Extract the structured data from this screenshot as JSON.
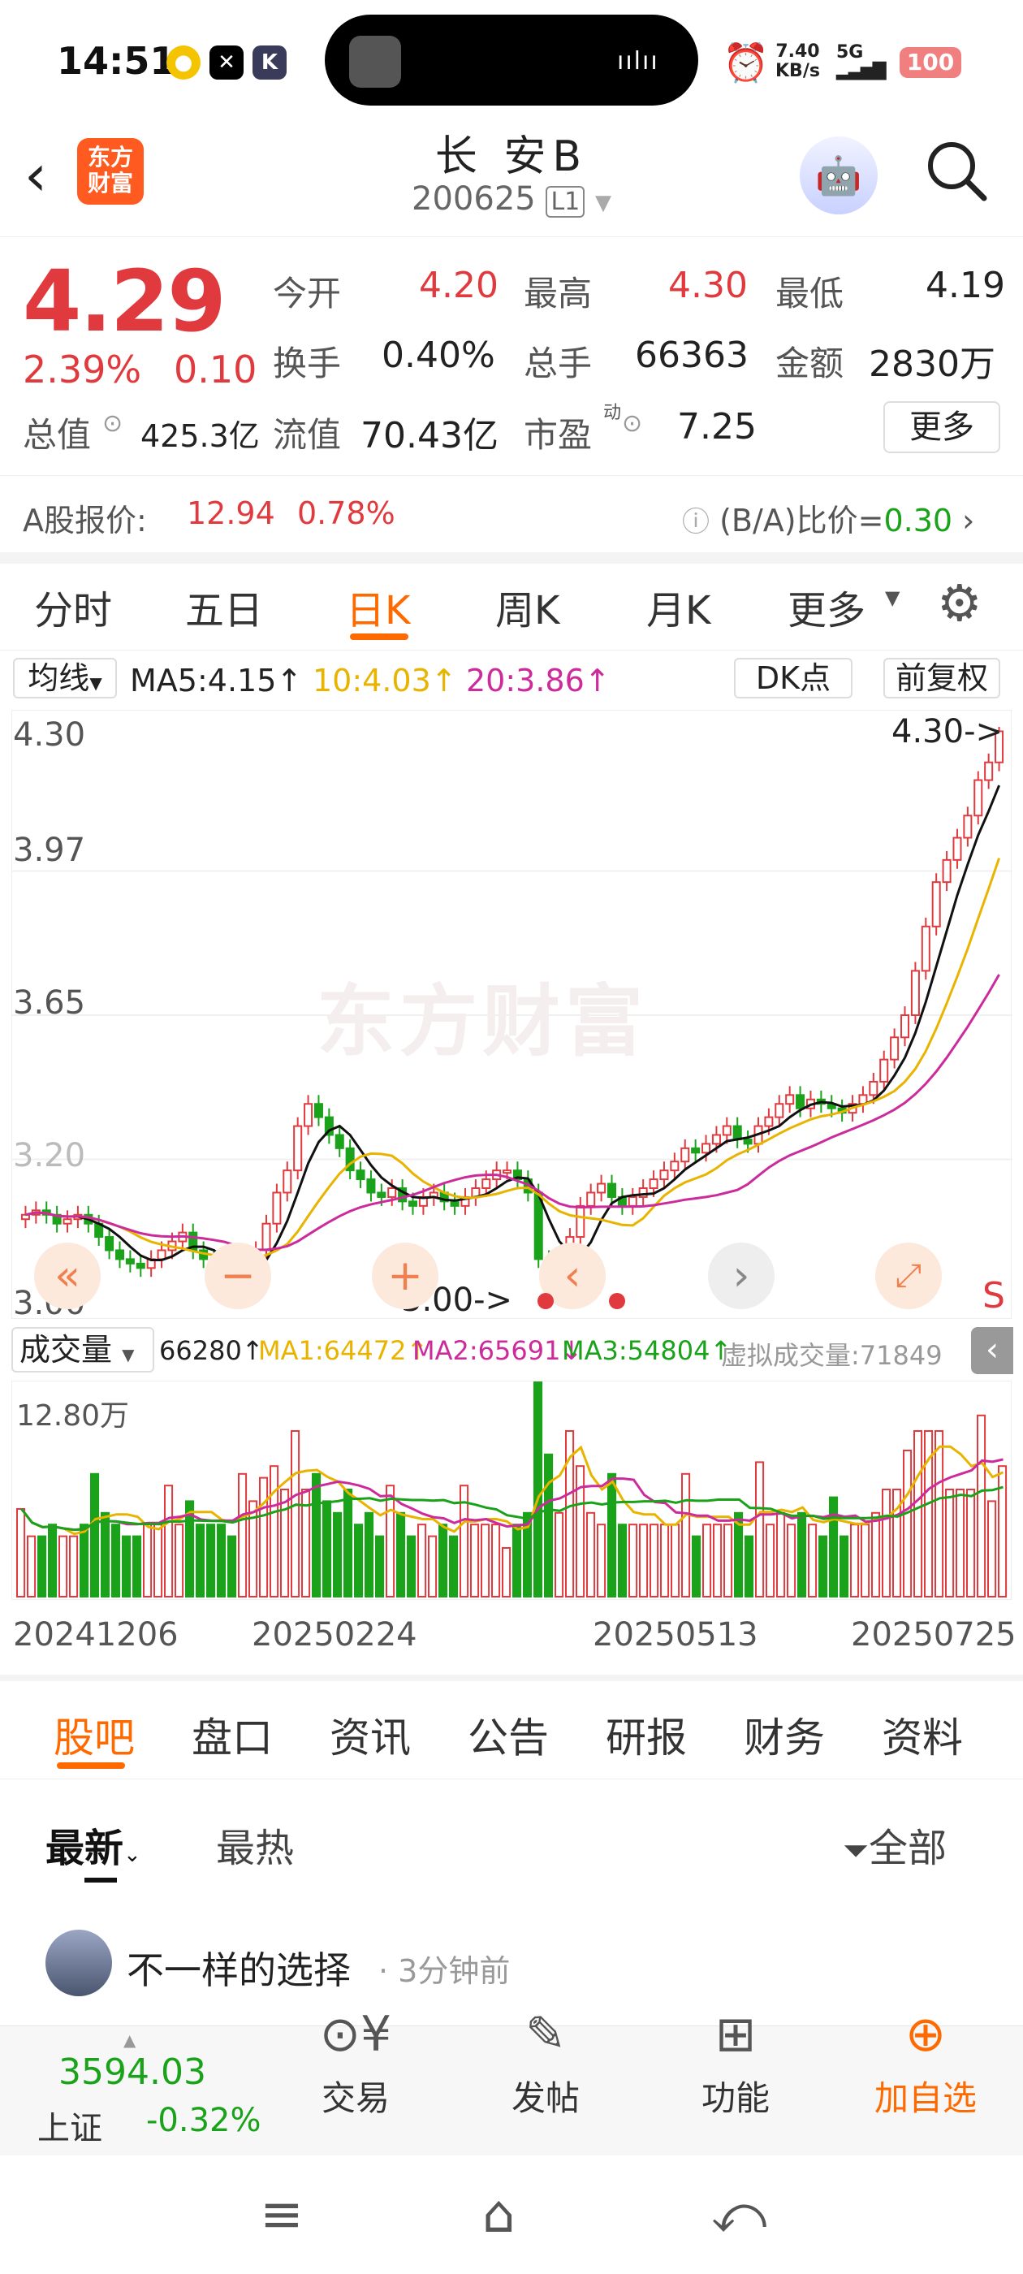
{
  "status": {
    "time": "14:51",
    "net": "7.40",
    "net_unit": "KB/s",
    "signal": "5G",
    "battery": "100"
  },
  "header": {
    "logo": "东方财富",
    "title": "长 安B",
    "code": "200625",
    "level": "L1"
  },
  "quote": {
    "price": "4.29",
    "pct": "2.39%",
    "chg": "0.10",
    "r1": [
      {
        "l": "今开",
        "v": "4.20"
      },
      {
        "l": "最高",
        "v": "4.30"
      },
      {
        "l": "最低",
        "v": "4.19"
      }
    ],
    "r2": [
      {
        "l": "换手",
        "v": "0.40%"
      },
      {
        "l": "总手",
        "v": "66363"
      },
      {
        "l": "金额",
        "v": "2830万"
      }
    ],
    "r3": {
      "total_label": "总值",
      "total": "425.3亿",
      "float_label": "流值",
      "float": "70.43亿",
      "pe_label": "市盈",
      "pe_sup": "动",
      "pe": "7.25"
    },
    "more": "更多"
  },
  "a_share": {
    "label": "A股报价:",
    "price": "12.94",
    "pct": "0.78%",
    "ratio_label": "(B/A)比价=",
    "ratio": "0.30"
  },
  "period_tabs": [
    "分时",
    "五日",
    "日K",
    "周K",
    "月K",
    "更多"
  ],
  "ma": {
    "type": "均线",
    "ma5": "MA5:4.15↑",
    "ma10": "10:4.03↑",
    "ma20": "20:3.86↑",
    "dk": "DK点",
    "adj": "前复权"
  },
  "price_axis": [
    "4.30",
    "3.97",
    "3.65",
    "3.20",
    "3.00"
  ],
  "marks": {
    "high": "4.30->",
    "low": "3.00->"
  },
  "watermark": "东方财富",
  "vol": {
    "label": "成交量",
    "v": "66280↑",
    "ma1": "MA1:64472↑",
    "ma2": "MA2:65691↓",
    "ma3": "MA3:54804↑",
    "virtual": "虚拟成交量:71849",
    "max": "12.80万"
  },
  "dates": [
    "20241206",
    "20250224",
    "20250513",
    "20250725"
  ],
  "bottom_tabs": [
    "股吧",
    "盘口",
    "资讯",
    "公告",
    "研报",
    "财务",
    "资料"
  ],
  "sort": {
    "latest": "最新",
    "hot": "最热",
    "filter": "全部"
  },
  "post": {
    "user": "不一样的选择",
    "time": "3分钟前"
  },
  "index": {
    "value": "3594.03",
    "name": "上证",
    "pct": "-0.32%"
  },
  "nav": [
    "交易",
    "发帖",
    "功能",
    "加自选"
  ],
  "colors": {
    "up": "#e03a3e",
    "down": "#1aa21a",
    "accent": "#ff6a00",
    "ma10": "#e8b400",
    "ma20": "#cc2b9b"
  },
  "chart_data": {
    "type": "candlestick",
    "ylim": [
      3.0,
      4.3
    ],
    "high": 4.3,
    "low": 3.0,
    "closes": [
      3.2,
      3.21,
      3.2,
      3.18,
      3.19,
      3.2,
      3.18,
      3.15,
      3.12,
      3.1,
      3.09,
      3.08,
      3.1,
      3.12,
      3.14,
      3.16,
      3.12,
      3.1,
      3.08,
      3.06,
      3.05,
      3.08,
      3.12,
      3.18,
      3.25,
      3.3,
      3.4,
      3.45,
      3.42,
      3.38,
      3.35,
      3.3,
      3.28,
      3.25,
      3.24,
      3.26,
      3.23,
      3.22,
      3.24,
      3.25,
      3.23,
      3.22,
      3.24,
      3.26,
      3.28,
      3.3,
      3.3,
      3.28,
      3.25,
      3.1,
      3.02,
      3.05,
      3.15,
      3.22,
      3.25,
      3.27,
      3.24,
      3.22,
      3.24,
      3.26,
      3.28,
      3.3,
      3.32,
      3.35,
      3.34,
      3.36,
      3.38,
      3.4,
      3.37,
      3.36,
      3.4,
      3.42,
      3.45,
      3.47,
      3.44,
      3.46,
      3.45,
      3.44,
      3.43,
      3.45,
      3.47,
      3.5,
      3.55,
      3.6,
      3.65,
      3.75,
      3.85,
      3.95,
      4.0,
      4.05,
      4.1,
      4.18,
      4.22,
      4.29
    ]
  }
}
